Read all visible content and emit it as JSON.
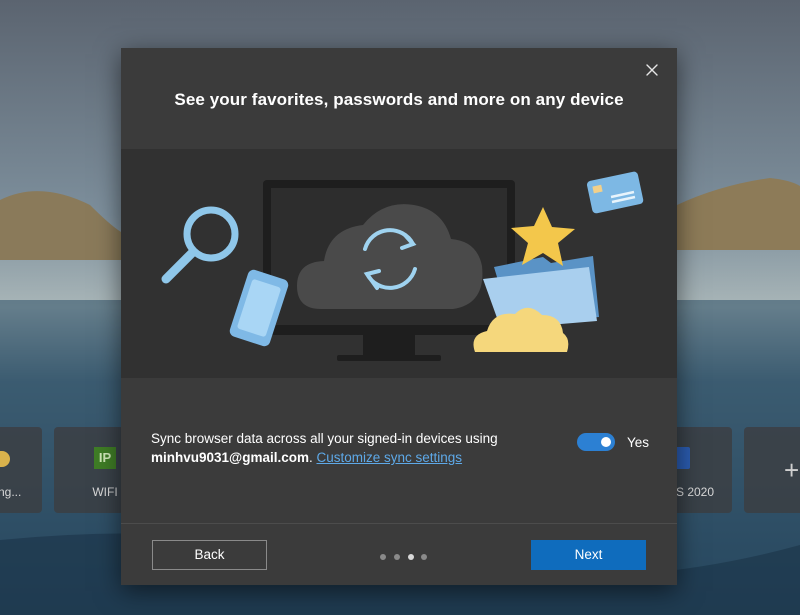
{
  "background": {
    "tiles": [
      {
        "label": "dong...",
        "icon": "app-icon"
      },
      {
        "label": "WIFI",
        "icon": "ip-icon",
        "icon_text": "IP"
      },
      {
        "label": "S 2020",
        "icon": "document-icon"
      },
      {
        "label": "",
        "icon": "plus-icon"
      }
    ]
  },
  "dialog": {
    "title": "See your favorites, passwords and more on any device",
    "sync_text": "Sync browser data across all your signed-in devices using",
    "email": "minhvu9031@gmail.com",
    "email_suffix": ". ",
    "customize_link": "Customize sync settings",
    "toggle_label": "Yes",
    "toggle_on": true,
    "back_label": "Back",
    "next_label": "Next",
    "page_dots": {
      "count": 4,
      "active": 3
    }
  },
  "colors": {
    "accent": "#0f6cbd",
    "toggle": "#2c80d3",
    "link": "#5ea9e8",
    "dialog_bg": "#3b3b3b",
    "hero_bg": "#313131"
  }
}
